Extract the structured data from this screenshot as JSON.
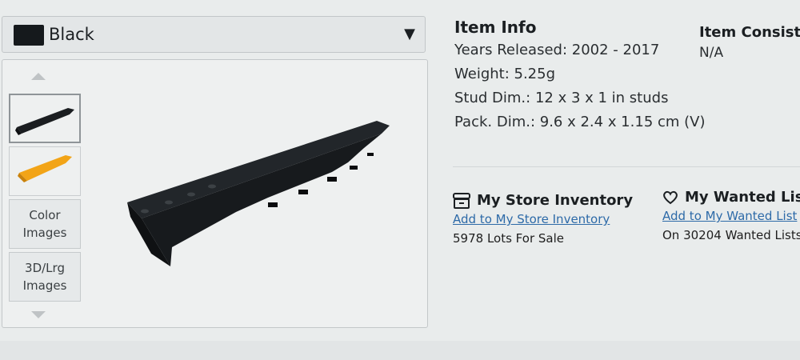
{
  "color_select": {
    "selected": "Black",
    "swatch_color": "#15191c"
  },
  "gallery": {
    "thumbnails": [
      {
        "name": "black-part-thumb",
        "color": "#1a1d20"
      },
      {
        "name": "orange-part-thumb",
        "color": "#f2a417"
      }
    ],
    "color_images_label": [
      "Color",
      "Images"
    ],
    "large_images_label": [
      "3D/Lrg",
      "Images"
    ]
  },
  "item_info": {
    "title": "Item Info",
    "years": "Years Released: 2002 - 2017",
    "weight": "Weight: 5.25g",
    "stud_dim": "Stud Dim.: 12 x 3 x 1 in studs",
    "pack_dim": "Pack. Dim.: 9.6 x 2.4 x 1.15 cm (V)"
  },
  "item_consists": {
    "title": "Item Consists",
    "value": "N/A"
  },
  "store_inventory": {
    "title": "My Store Inventory",
    "link": "Add to My Store Inventory",
    "note": "5978 Lots For Sale"
  },
  "wanted_list": {
    "title": "My Wanted List",
    "link": "Add to My Wanted List",
    "note": "On 30204 Wanted Lists"
  }
}
